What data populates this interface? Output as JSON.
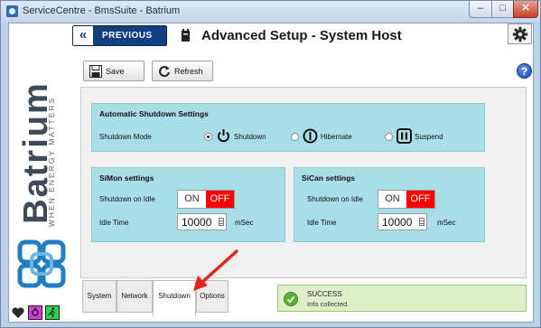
{
  "window": {
    "title": "ServiceCentre - BmsSuite - Batrium",
    "minimize_glyph": "–",
    "maximize_glyph": "□",
    "close_glyph": "✕"
  },
  "brand": {
    "logo_text": "Batrium",
    "tagline": "WHEN ENERGY MATTERS",
    "logo_icon": "batrium-chain-logo"
  },
  "header": {
    "back_label": "PREVIOUS",
    "back_glyph": "«",
    "title": "Advanced Setup - System Host",
    "host_icon": "host-tower-icon",
    "settings_icon": "gear-icon"
  },
  "toolbar": {
    "save_label": "Save",
    "refresh_label": "Refresh",
    "help_glyph": "?"
  },
  "auto_shutdown": {
    "title": "Automatic Shutdown Settings",
    "mode_label": "Shutdown Mode",
    "options": [
      {
        "label": "Shutdown",
        "icon": "power-icon",
        "selected": true
      },
      {
        "label": "Hibernate",
        "icon": "hibernate-icon",
        "selected": false
      },
      {
        "label": "Suspend",
        "icon": "pause-icon",
        "selected": false
      }
    ]
  },
  "simon": {
    "title": "SiMon settings",
    "idle_label": "Shutdown on Idle",
    "on_label": "ON",
    "off_label": "OFF",
    "toggle_state": "OFF",
    "idle_time_label": "Idle Time",
    "idle_time_value": "10000",
    "idle_time_unit": "mSec"
  },
  "sican": {
    "title": "SiCan settings",
    "idle_label": "Shutdown on Idle",
    "on_label": "ON",
    "off_label": "OFF",
    "toggle_state": "OFF",
    "idle_time_label": "Idle Time",
    "idle_time_value": "10000",
    "idle_time_unit": "mSec"
  },
  "tabs": [
    {
      "label": "System",
      "active": false
    },
    {
      "label": "Network",
      "active": false
    },
    {
      "label": "Shutdown",
      "active": true
    },
    {
      "label": "Options",
      "active": false
    }
  ],
  "status": {
    "title": "SUCCESS",
    "message": "Info collected.",
    "icon": "check-icon"
  },
  "status_icons": [
    "heart-icon",
    "tool-icon",
    "running-icon"
  ],
  "colors": {
    "accent_navy": "#123f7d",
    "panel_cyan": "#a9dde8",
    "toggle_off_red": "#ff0000",
    "success_green": "#5cae3a",
    "success_bg": "#dff0c9",
    "callout_arrow": "#e0261b"
  }
}
